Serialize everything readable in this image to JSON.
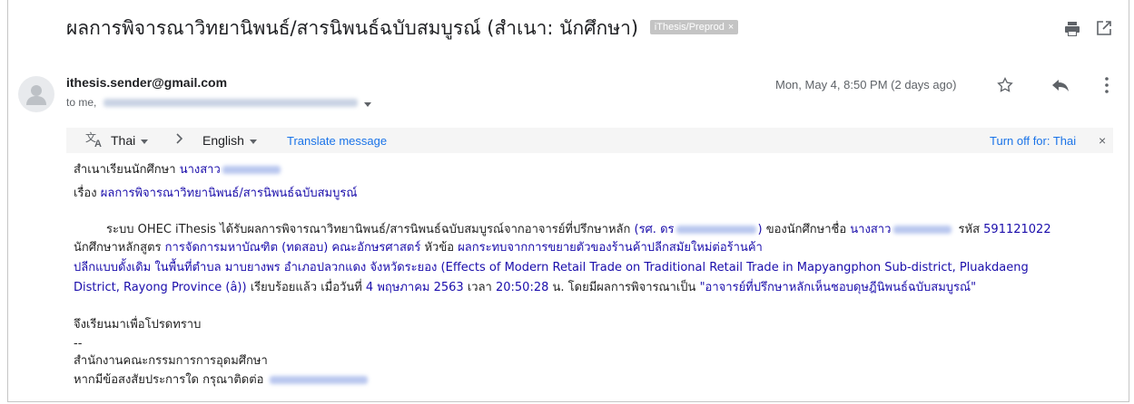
{
  "subject": "ผลการพิจารณาวิทยานิพนธ์/สารนิพนธ์ฉบับสมบูรณ์ (สำเนา: นักศึกษา)",
  "label_chip": "iThesis/Preprod",
  "label_chip_close": "×",
  "sender": {
    "email": "ithesis.sender@gmail.com",
    "to_prefix": "to me,"
  },
  "date": "Mon, May 4, 8:50 PM (2 days ago)",
  "translate": {
    "from_lang": "Thai",
    "to_lang": "English",
    "translate_link": "Translate message",
    "turn_off": "Turn off for: Thai",
    "close": "×"
  },
  "body": {
    "line1_label": "สำเนาเรียนนักศึกษา",
    "line1_value": "นางสาว",
    "line2_label": "เรื่อง",
    "line2_value": "ผลการพิจารณาวิทยานิพนธ์/สารนิพนธ์ฉบับสมบูรณ์",
    "p1_a": "ระบบ OHEC iThesis ได้รับผลการพิจารณาวิทยานิพนธ์/สารนิพนธ์ฉบับสมบูรณ์จากอาจารย์ที่ปรึกษาหลัก",
    "p1_b": "(รศ. ดร",
    "p1_c": ")",
    "p1_d": "ของนักศึกษาชื่อ",
    "p1_e": "นางสาว",
    "p1_f": "รหัส",
    "p1_g": "591121022",
    "p2_a": "นักศึกษาหลักสูตร",
    "p2_b": "การจัดการมหาบัณฑิต (ทดสอบ) คณะอักษรศาสตร์",
    "p2_c": "หัวข้อ",
    "p2_d": "ผลกระทบจากการขยายตัวของร้านค้าปลีกสมัยใหม่ต่อร้านค้า",
    "p3": "ปลีกแบบดั้งเดิม ในพื้นที่ตำบล มาบยางพร อำเภอปลวกแดง จังหวัดระยอง (Effects of Modern Retail Trade on Traditional Retail Trade in Mapyangphon Sub-district, Pluakdaeng",
    "p4_a": "District, Rayong Province (â))",
    "p4_b": "เรียบร้อยแล้ว เมื่อวันที่",
    "p4_c": "4 พฤษภาคม 2563",
    "p4_d": "เวลา",
    "p4_e": "20:50:28",
    "p4_f": "น. โดยมีผลการพิจารณาเป็น",
    "p4_g": "\"อาจารย์ที่ปรึกษาหลักเห็นชอบดุษฎีนิพนธ์ฉบับสมบูรณ์\"",
    "closing": "จึงเรียนมาเพื่อโปรดทราบ",
    "sig_dash": "--",
    "sig_org": "สำนักงานคณะกรรมการการอุดมศึกษา",
    "sig_contact": "หากมีข้อสงสัยประการใด กรุณาติดต่อ"
  },
  "icons": {
    "print": "print-icon",
    "popout": "open-in-new-window-icon",
    "star": "star-icon",
    "reply": "reply-icon",
    "more": "more-vertical-icon",
    "translate": "translate-icon"
  }
}
